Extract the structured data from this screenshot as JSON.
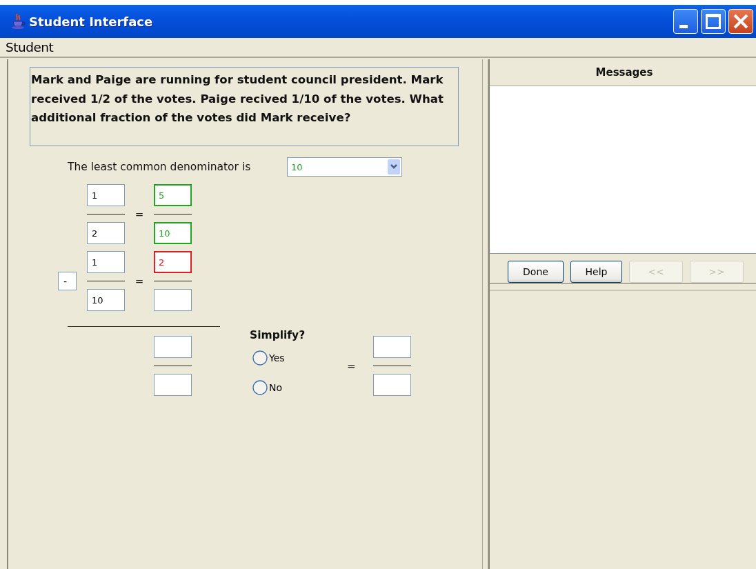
{
  "window": {
    "title": "Student Interface"
  },
  "menu": [
    "Student"
  ],
  "problem": {
    "text": "Mark and Paige are running for student council president. Mark received 1/2 of the votes. Paige recived 1/10 of the votes. What additional fraction of the votes did Mark receive?"
  },
  "lcd": {
    "label": "The least common denominator is",
    "value": "10",
    "correct": true,
    "incorrect": false
  },
  "fractions": [
    {
      "left": {
        "numerator": {
          "value": "1",
          "correct": false,
          "incorrect": false
        },
        "denominator": {
          "value": "2",
          "correct": false,
          "incorrect": false
        }
      },
      "equals": "=",
      "right": {
        "numerator": {
          "value": "5",
          "correct": true,
          "incorrect": false
        },
        "denominator": {
          "value": "10",
          "correct": true,
          "incorrect": false
        }
      }
    },
    {
      "operator": "-",
      "left": {
        "numerator": {
          "value": "1",
          "correct": false,
          "incorrect": false
        },
        "denominator": {
          "value": "10",
          "correct": false,
          "incorrect": false
        }
      },
      "equals": "=",
      "right": {
        "numerator": {
          "value": "2",
          "correct": false,
          "incorrect": true
        },
        "denominator": {
          "correct": false,
          "incorrect": false
        }
      }
    }
  ],
  "result": {
    "numerator": {
      "correct": false,
      "incorrect": false
    },
    "denominator": {
      "correct": false,
      "incorrect": false
    }
  },
  "simplify": {
    "label": "Simplify?",
    "options": [
      {
        "label": "Yes",
        "selected": false
      },
      {
        "label": "No",
        "selected": false
      }
    ]
  },
  "simplified": {
    "equals": "=",
    "numerator": {
      "correct": false,
      "incorrect": false
    },
    "denominator": {
      "correct": false,
      "incorrect": false
    }
  },
  "messages": {
    "title": "Messages"
  },
  "buttons": [
    {
      "label": "Done",
      "disabled": false
    },
    {
      "label": "Help",
      "disabled": false
    },
    {
      "label": "<<",
      "disabled": true
    },
    {
      "label": ">>",
      "disabled": true
    }
  ]
}
